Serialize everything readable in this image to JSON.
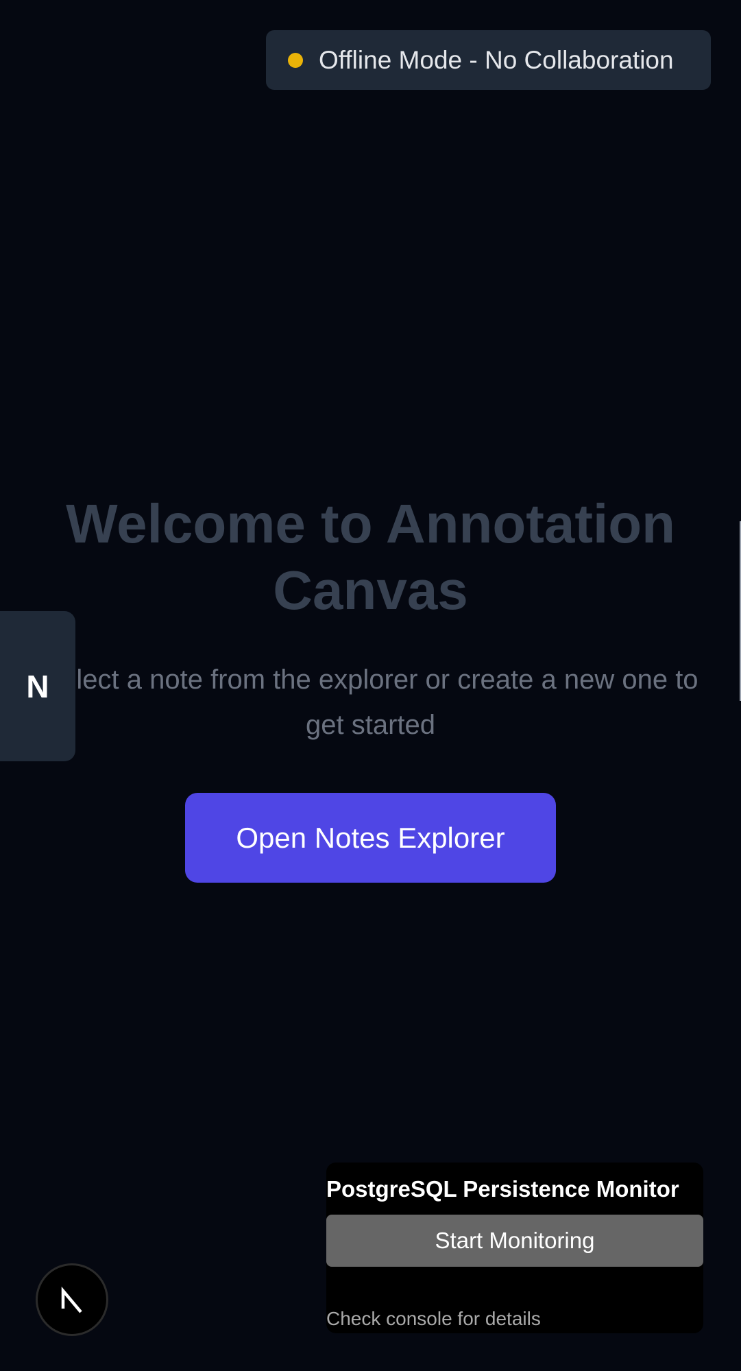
{
  "status": {
    "label": "Offline Mode - No Collaboration",
    "dot_color": "#eab308"
  },
  "welcome": {
    "title": "Welcome to Annotation Canvas",
    "subtitle_line1": "Select a note from the explorer or create a new one to",
    "subtitle_line2": "get started",
    "cta_label": "Open Notes Explorer",
    "cta_color": "#4f46e5"
  },
  "notes_tab": {
    "letter": "N"
  },
  "monitor": {
    "title": "PostgreSQL Persistence Monitor",
    "button_label": "Start Monitoring",
    "note": "Check console for details"
  },
  "dev_badge": {
    "icon": "nextjs-logo-icon"
  },
  "colors": {
    "background": "#050811",
    "panel": "#1f2937"
  }
}
